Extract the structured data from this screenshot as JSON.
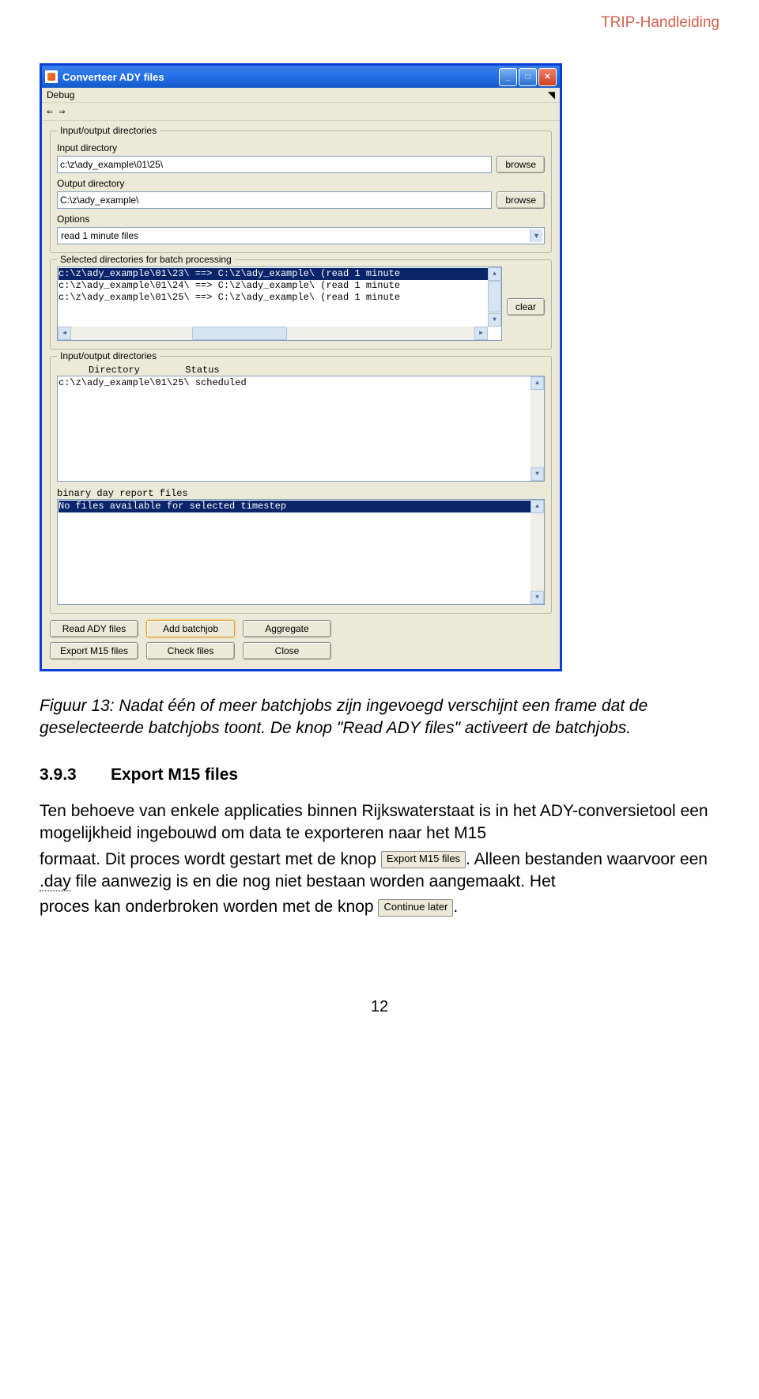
{
  "header": {
    "right": "TRIP-Handleiding"
  },
  "window": {
    "title": "Converteer ADY files",
    "menu": {
      "debug": "Debug",
      "extra": "◥"
    },
    "toolbar": {
      "arrows": "⇐ ⇒"
    },
    "group1": {
      "legend": "Input/output directories",
      "input_dir_label": "Input directory",
      "input_dir_value": "c:\\z\\ady_example\\01\\25\\",
      "output_dir_label": "Output directory",
      "output_dir_value": "C:\\z\\ady_example\\",
      "browse": "browse",
      "options_label": "Options",
      "options_value": "read 1 minute files"
    },
    "group2": {
      "legend": "Selected directories for batch processing",
      "rows": [
        "c:\\z\\ady_example\\01\\23\\ ==> C:\\z\\ady_example\\ (read 1 minute",
        "c:\\z\\ady_example\\01\\24\\ ==> C:\\z\\ady_example\\ (read 1 minute",
        "c:\\z\\ady_example\\01\\25\\ ==> C:\\z\\ady_example\\ (read 1 minute"
      ],
      "clear": "clear"
    },
    "group3": {
      "legend": "Input/output directories",
      "col_dir": "Directory",
      "col_status": "Status",
      "row1_dir": "c:\\z\\ady_example\\01\\25\\",
      "row1_status": "scheduled",
      "binary_label": "binary day report files",
      "nofiles": "No files available for selected timestep"
    },
    "buttons": {
      "read": "Read ADY files",
      "add": "Add batchjob",
      "agg": "Aggregate",
      "export": "Export M15 files",
      "check": "Check files",
      "close": "Close"
    }
  },
  "doc": {
    "caption": "Figuur 13: Nadat één of meer batchjobs zijn ingevoegd verschijnt een frame dat de geselecteerde batchjobs toont. De knop \"Read ADY files\" activeert de batchjobs.",
    "sec_num": "3.9.3",
    "sec_title": "Export M15 files",
    "p1a": "Ten behoeve van enkele applicaties binnen Rijkswaterstaat is in het ADY-conversietool een mogelijkheid ingebouwd om data te exporteren naar het M15",
    "p2a": "formaat. Dit proces wordt gestart met de knop ",
    "btn1": "Export M15 files",
    "p2b": ". Alleen bestanden waarvoor een ",
    "day": ".day",
    "p2c": " file aanwezig is en die nog niet bestaan worden aangemaakt. Het",
    "p3a": "proces kan onderbroken worden met de knop ",
    "btn2": "Continue later",
    "p3b": ".",
    "page_number": "12"
  }
}
